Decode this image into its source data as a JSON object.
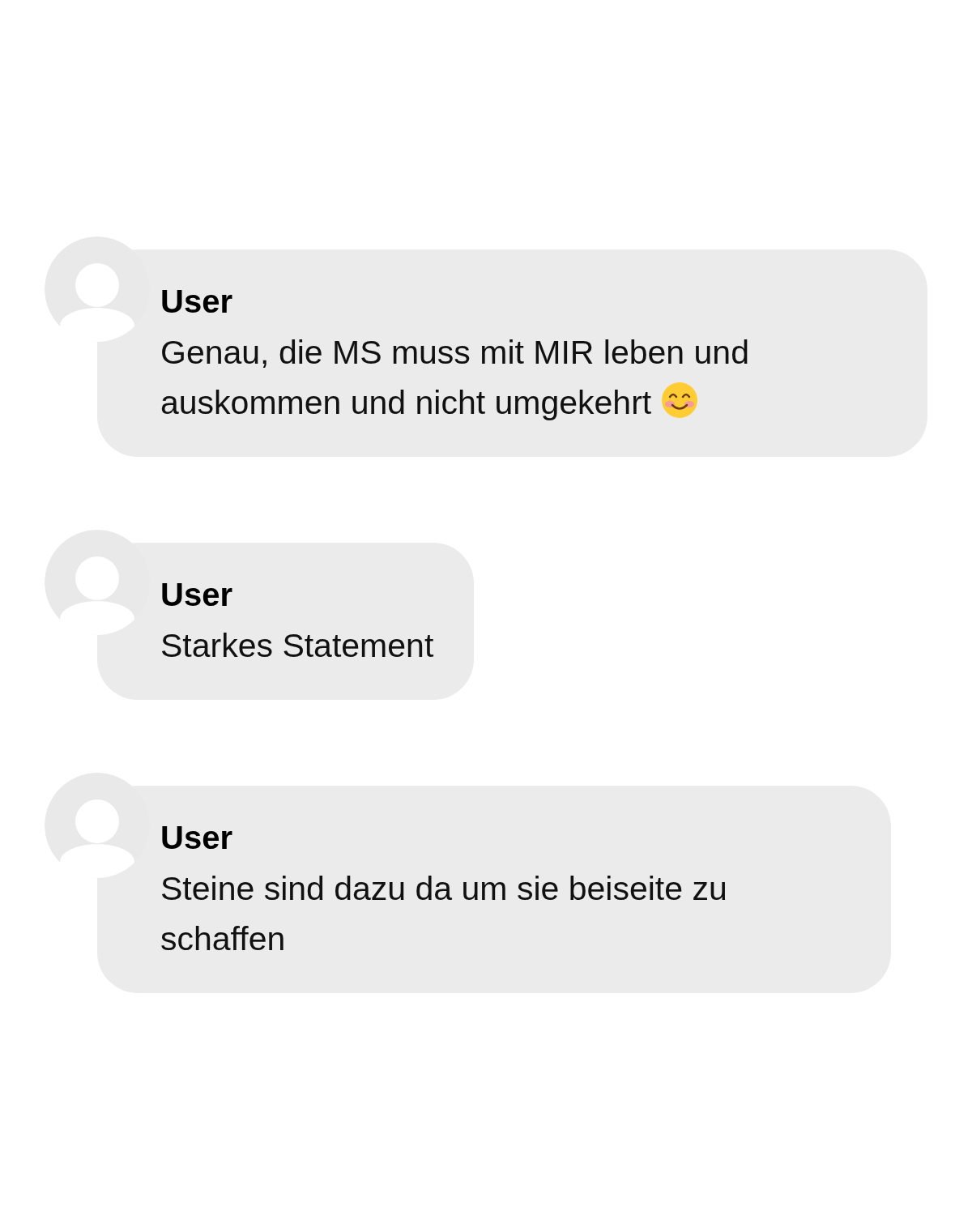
{
  "comments": [
    {
      "author": "User",
      "text": "Genau, die MS muss mit MIR leben und auskommen und nicht umgekehrt",
      "emoji": true
    },
    {
      "author": "User",
      "text": "Starkes Statement",
      "emoji": false
    },
    {
      "author": "User",
      "text": "Steine sind dazu da um sie beiseite zu schaffen",
      "emoji": false
    }
  ]
}
